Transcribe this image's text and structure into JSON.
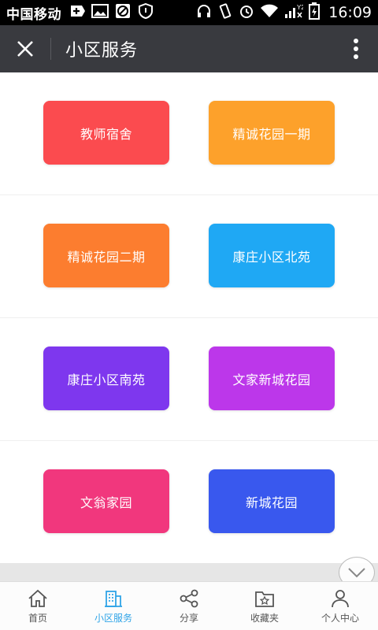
{
  "status_bar": {
    "carrier": "中国移动",
    "time": "16:09",
    "signal_label": "Y2"
  },
  "header": {
    "title": "小区服务"
  },
  "tiles": [
    {
      "label": "教师宿舍",
      "color": "#fb4b4f"
    },
    {
      "label": "精诚花园一期",
      "color": "#fda12b"
    },
    {
      "label": "精诚花园二期",
      "color": "#fc7d2f"
    },
    {
      "label": "康庄小区北苑",
      "color": "#1fa8f4"
    },
    {
      "label": "康庄小区南苑",
      "color": "#7e37ee"
    },
    {
      "label": "文家新城花园",
      "color": "#bc37ea"
    },
    {
      "label": "文翁家园",
      "color": "#f1377d"
    },
    {
      "label": "新城花园",
      "color": "#3958ee"
    }
  ],
  "bottom_nav": {
    "items": [
      {
        "label": "首页",
        "icon": "home-icon"
      },
      {
        "label": "小区服务",
        "icon": "building-icon"
      },
      {
        "label": "分享",
        "icon": "share-icon"
      },
      {
        "label": "收藏夹",
        "icon": "folder-star-icon"
      },
      {
        "label": "个人中心",
        "icon": "person-icon"
      }
    ],
    "active_index": 1,
    "active_color": "#2fa4e7"
  },
  "colors": {
    "header_bg": "#393a3f",
    "status_bg": "#000000"
  }
}
